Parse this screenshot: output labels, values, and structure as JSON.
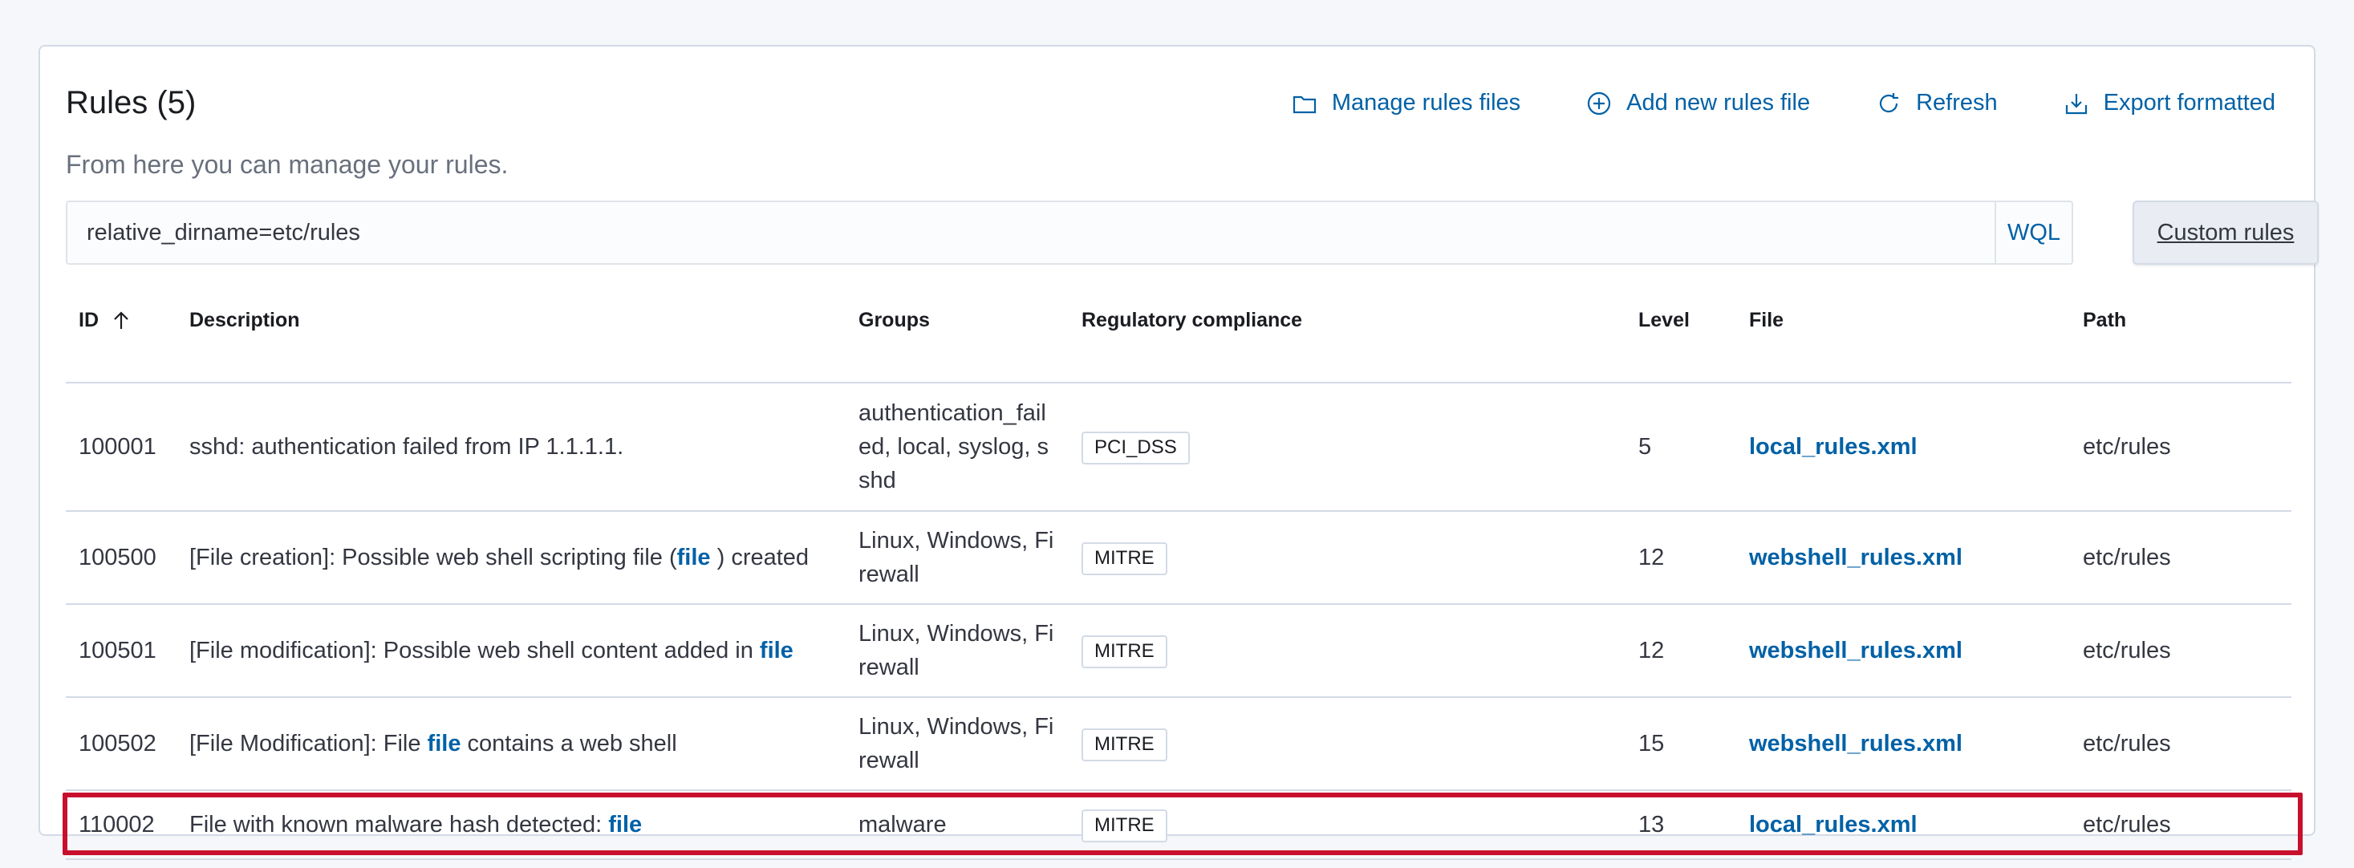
{
  "header": {
    "title": "Rules (5)",
    "subtitle": "From here you can manage your rules.",
    "actions": [
      {
        "label": "Manage rules files",
        "icon": "folder-icon"
      },
      {
        "label": "Add new rules file",
        "icon": "plus-circle-icon"
      },
      {
        "label": "Refresh",
        "icon": "refresh-icon"
      },
      {
        "label": "Export formatted",
        "icon": "export-icon"
      }
    ]
  },
  "search": {
    "value": "relative_dirname=etc/rules",
    "wql_label": "WQL",
    "custom_rules_label": "Custom rules"
  },
  "table": {
    "columns": [
      "ID",
      "Description",
      "Groups",
      "Regulatory compliance",
      "Level",
      "File",
      "Path"
    ],
    "sort_column": "ID",
    "sort_direction": "ascending",
    "rows": [
      {
        "id": "100001",
        "description_parts": [
          {
            "text": "sshd: authentication failed from IP 1.1.1.1.",
            "link": false
          }
        ],
        "groups": "authentication_failed, local, syslog, sshd",
        "compliance": "PCI_DSS",
        "level": "5",
        "file": "local_rules.xml",
        "path": "etc/rules"
      },
      {
        "id": "100500",
        "description_parts": [
          {
            "text": "[File creation]: Possible web shell scripting file (",
            "link": false
          },
          {
            "text": "file",
            "link": true
          },
          {
            "text": " ) created",
            "link": false
          }
        ],
        "groups": "Linux, Windows, Firewall",
        "compliance": "MITRE",
        "level": "12",
        "file": "webshell_rules.xml",
        "path": "etc/rules"
      },
      {
        "id": "100501",
        "description_parts": [
          {
            "text": "[File modification]: Possible web shell content added in ",
            "link": false
          },
          {
            "text": "file",
            "link": true
          }
        ],
        "groups": "Linux, Windows, Firewall",
        "compliance": "MITRE",
        "level": "12",
        "file": "webshell_rules.xml",
        "path": "etc/rules"
      },
      {
        "id": "100502",
        "description_parts": [
          {
            "text": "[File Modification]: File ",
            "link": false
          },
          {
            "text": "file",
            "link": true
          },
          {
            "text": " contains a web shell",
            "link": false
          }
        ],
        "groups": "Linux, Windows, Firewall",
        "compliance": "MITRE",
        "level": "15",
        "file": "webshell_rules.xml",
        "path": "etc/rules"
      },
      {
        "id": "110002",
        "description_parts": [
          {
            "text": "File with known malware hash detected: ",
            "link": false
          },
          {
            "text": "file",
            "link": true
          }
        ],
        "groups": "malware",
        "compliance": "MITRE",
        "level": "13",
        "file": "local_rules.xml",
        "path": "etc/rules",
        "highlighted": true
      }
    ]
  },
  "colors": {
    "link": "#0061a6",
    "highlight_border": "#c8102e",
    "border": "#d3dae6"
  }
}
